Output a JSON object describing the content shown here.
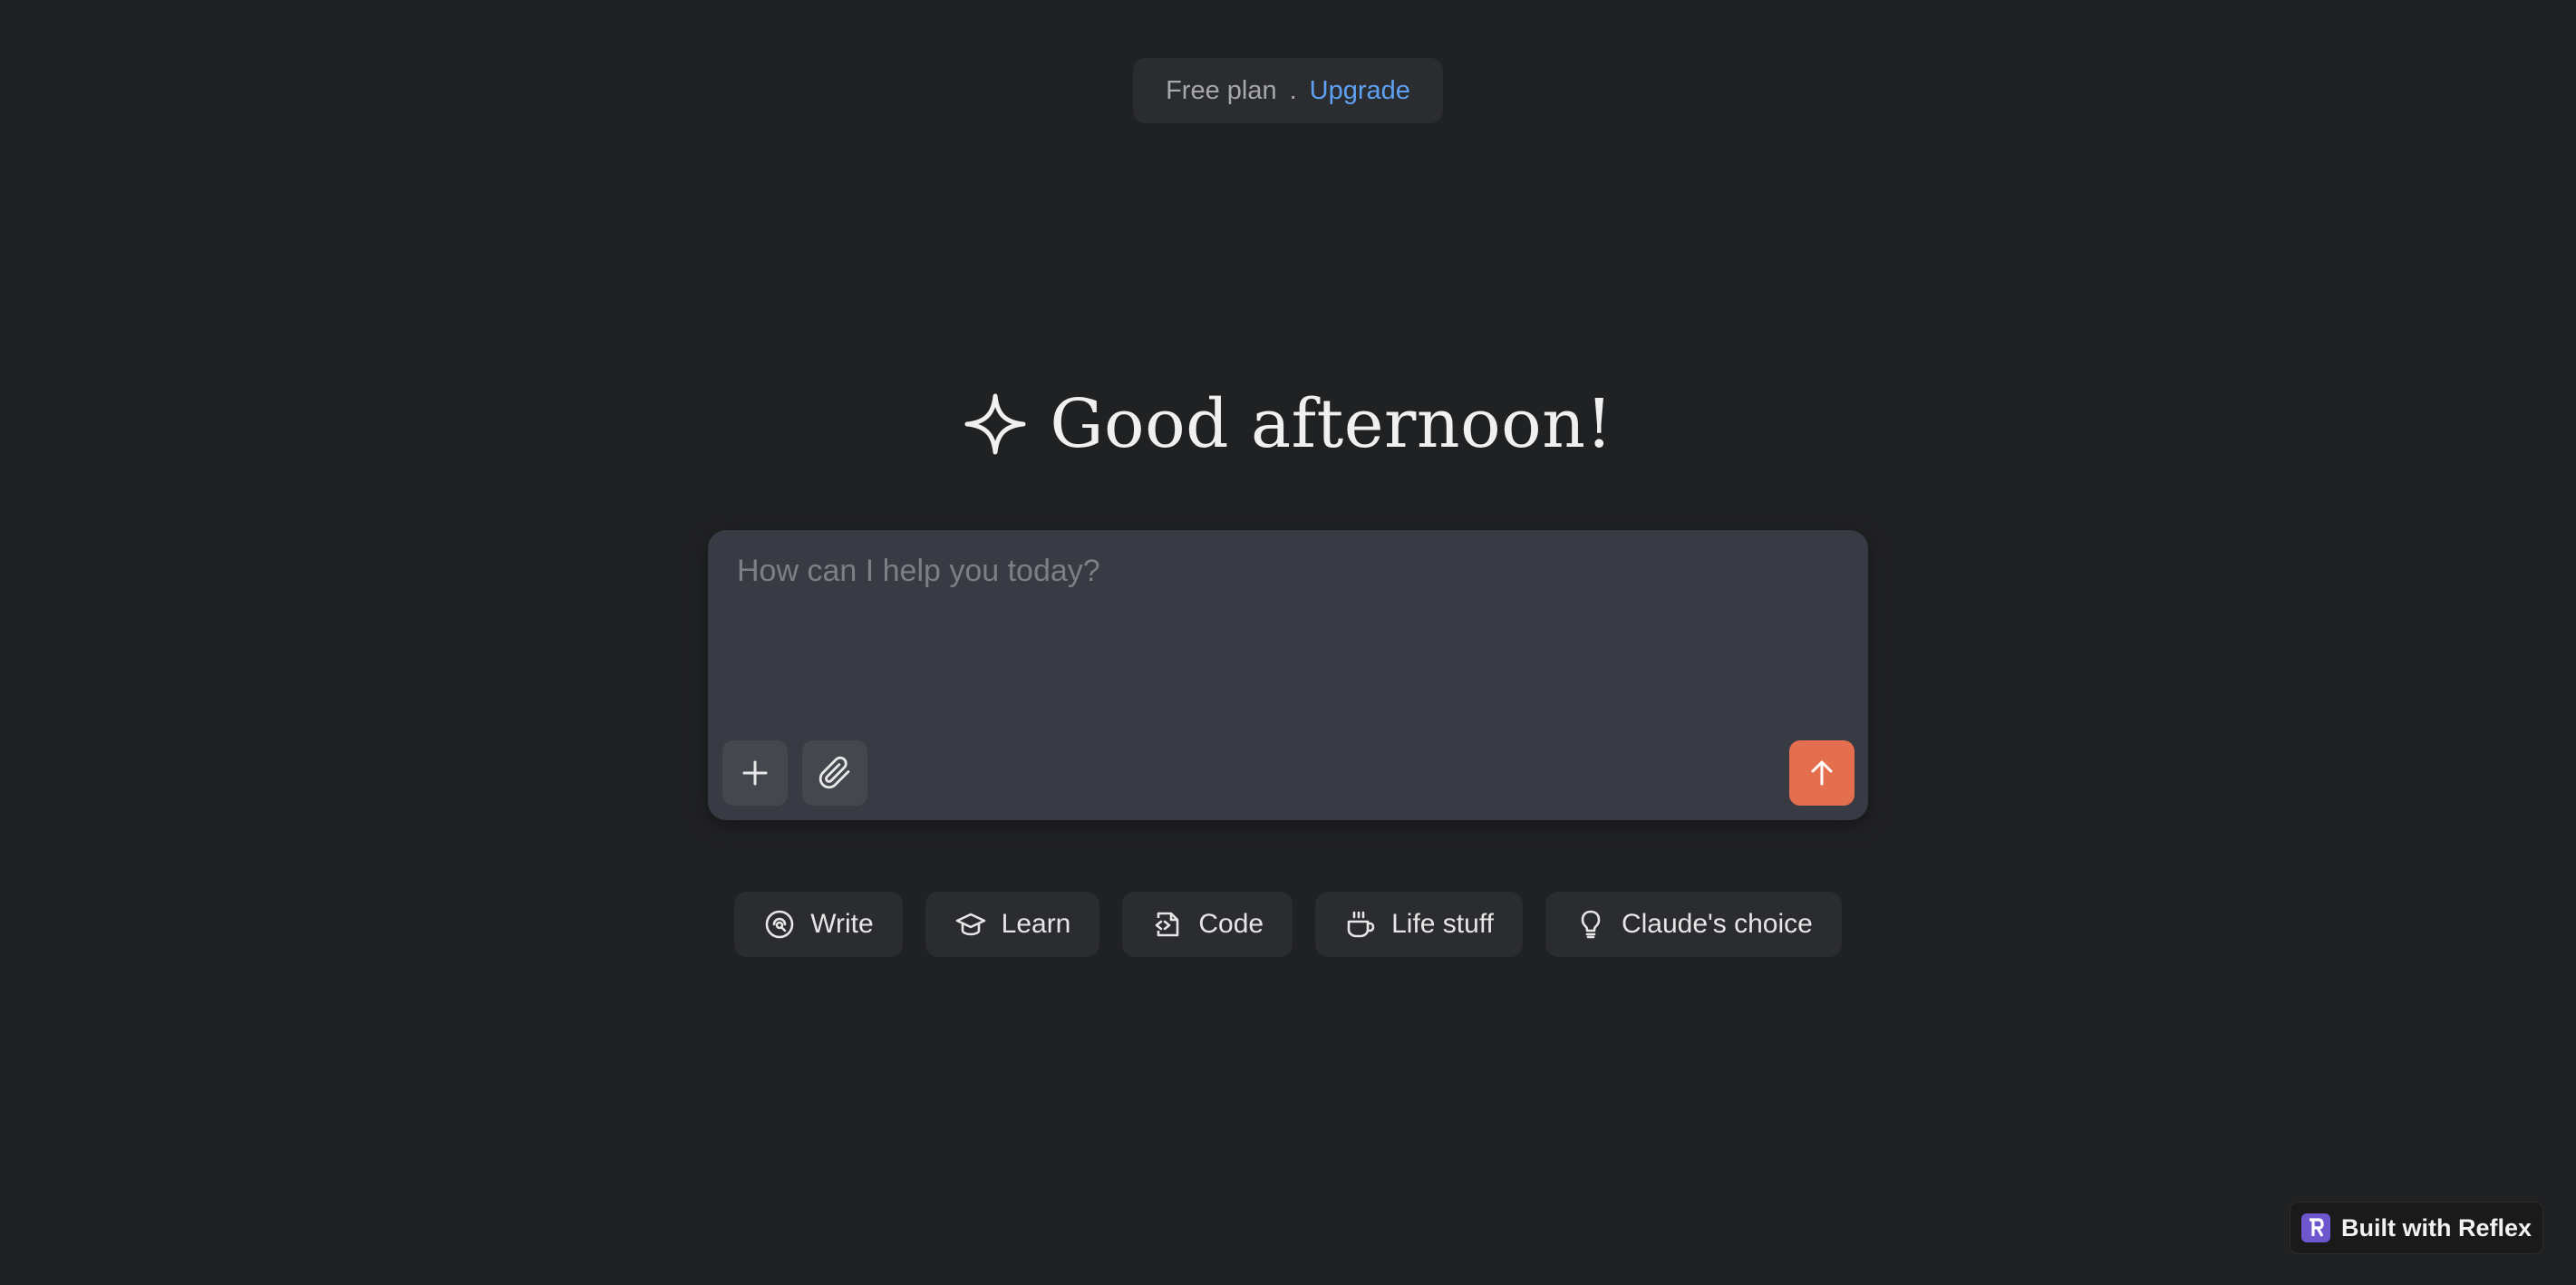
{
  "plan": {
    "label": "Free plan",
    "separator": ".",
    "upgrade_label": "Upgrade"
  },
  "greeting": {
    "icon": "sparkle-icon",
    "text": "Good afternoon!"
  },
  "composer": {
    "placeholder": "How can I help you today?",
    "value": "",
    "buttons": {
      "add": "plus-icon",
      "attach": "paperclip-icon",
      "send": "arrow-up-icon"
    },
    "send_color": "#e36f4f"
  },
  "chips": [
    {
      "icon": "write-icon",
      "label": "Write"
    },
    {
      "icon": "graduation-cap-icon",
      "label": "Learn"
    },
    {
      "icon": "code-file-icon",
      "label": "Code"
    },
    {
      "icon": "coffee-cup-icon",
      "label": "Life stuff"
    },
    {
      "icon": "lightbulb-icon",
      "label": "Claude's choice"
    }
  ],
  "badge": {
    "logo_letter": "R",
    "text": "Built with Reflex",
    "logo_color": "#6e56cf"
  },
  "colors": {
    "background": "#202123",
    "composer": "#383a44",
    "link": "#5ea0f2"
  }
}
